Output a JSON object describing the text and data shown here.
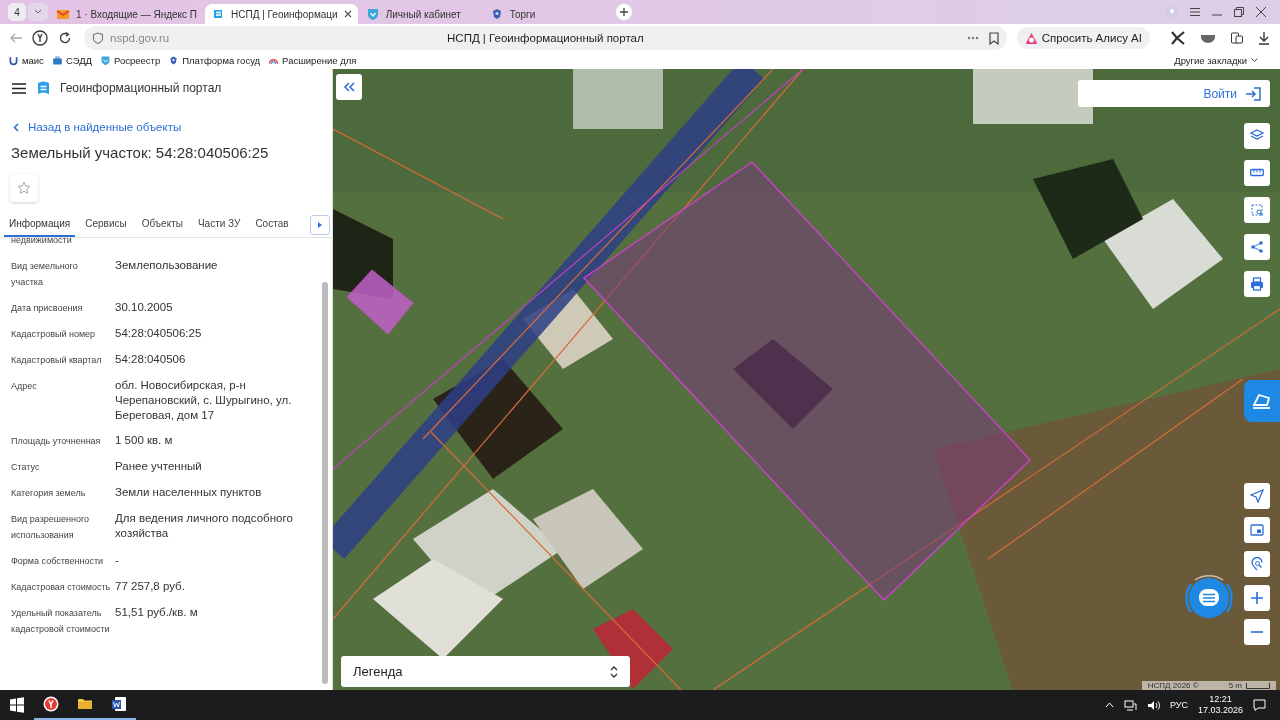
{
  "browser": {
    "tab_count": "4",
    "tabs": [
      {
        "title": "1 · Входящие — Яндекс П",
        "selected": false,
        "kind": "mail"
      },
      {
        "title": "НСПД | Геоинформаци",
        "selected": true,
        "kind": "portal"
      },
      {
        "title": "Личный кабинет",
        "selected": false,
        "kind": "shield"
      },
      {
        "title": "Торги",
        "selected": false,
        "kind": "emblem"
      }
    ],
    "url": "nspd.gov.ru",
    "page_title": "НСПД | Геоинформационный портал",
    "assistant_button": "Спросить Алису AI",
    "bookmarks": [
      {
        "label": "маис",
        "kind": "mais"
      },
      {
        "label": "СЭДД",
        "kind": "briefcase"
      },
      {
        "label": "Росреестр",
        "kind": "shield"
      },
      {
        "label": "Платформа госуд",
        "kind": "emblem"
      },
      {
        "label": "Расширение для",
        "kind": "rainbow"
      }
    ],
    "other_bookmarks": "Другие закладки"
  },
  "portal": {
    "title": "Геоинформационный портал",
    "back_link": "Назад в найденные объекты",
    "heading": "Земельный участок: 54:28:040506:25",
    "favorite": false,
    "tabs": [
      {
        "label": "Информация",
        "selected": true
      },
      {
        "label": "Сервисы",
        "selected": false
      },
      {
        "label": "Объекты",
        "selected": false
      },
      {
        "label": "Части ЗУ",
        "selected": false
      },
      {
        "label": "Состав",
        "selected": false
      }
    ],
    "properties": [
      {
        "label": "недвижимости"
      },
      {
        "label": "Вид земельного участка",
        "value": "Землепользование"
      },
      {
        "label": "Дата присвоения",
        "value": "30.10.2005"
      },
      {
        "label": "Кадастровый номер",
        "value": "54:28:040506:25"
      },
      {
        "label": "Кадастровый квартал",
        "value": "54:28:040506"
      },
      {
        "label": "Адрес",
        "value": "обл. Новосибирская, р-н Черепановский, с. Шурыгино, ул. Береговая, дом 17"
      },
      {
        "label": "Площадь уточненная",
        "value": "1 500 кв. м"
      },
      {
        "label": "Статус",
        "value": "Ранее учтенный"
      },
      {
        "label": "Категория земель",
        "value": "Земли населенных пунктов"
      },
      {
        "label": "Вид разрешенного использования",
        "value": "Для ведения личного подсобного хозяйства"
      },
      {
        "label": "Форма собственности",
        "value": "-"
      },
      {
        "label": "Кадастровая стоимость",
        "value": "77 257,8 руб."
      },
      {
        "label": "Удельный показатель кадастровой стоимости",
        "value": "51,51 руб./кв. м"
      }
    ]
  },
  "map": {
    "login_button": "Войти",
    "legend": "Легенда",
    "attribution": "НСПД 2026 ©",
    "scale": "5 m",
    "tools": [
      {
        "kind": "layers"
      },
      {
        "kind": "ruler"
      },
      {
        "kind": "select"
      },
      {
        "kind": "share"
      },
      {
        "kind": "print"
      }
    ],
    "nav_tools": [
      {
        "kind": "locate"
      },
      {
        "kind": "minimap"
      },
      {
        "kind": "search-location"
      },
      {
        "kind": "zoom-in"
      },
      {
        "kind": "zoom-out"
      }
    ]
  },
  "taskbar": {
    "language": "РУС",
    "time": "12:21",
    "date": "17.03.2026"
  }
}
